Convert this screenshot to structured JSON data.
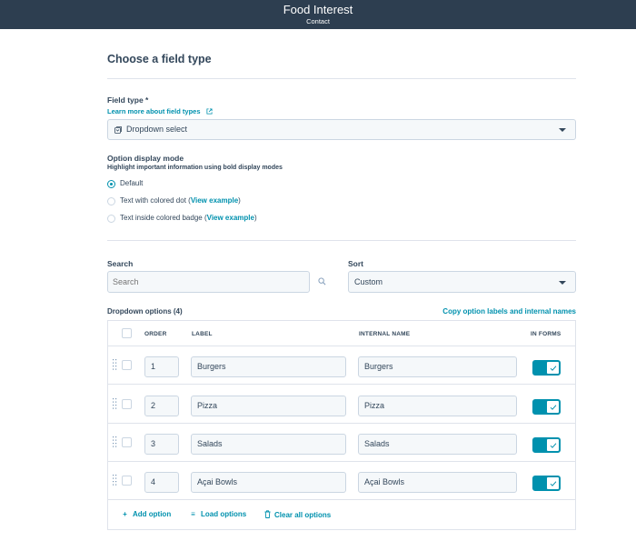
{
  "header": {
    "title": "Food Interest",
    "subtitle": "Contact"
  },
  "section_title": "Choose a field type",
  "field_type": {
    "label": "Field type *",
    "help_link": "Learn more about field types",
    "selected": "Dropdown select"
  },
  "display_mode": {
    "label": "Option display mode",
    "helper": "Highlight important information using bold display modes",
    "options": [
      {
        "text": "Default",
        "link": "",
        "suffix": "",
        "checked": true
      },
      {
        "text": "Text with colored dot (",
        "link": "View example",
        "suffix": ")",
        "checked": false
      },
      {
        "text": "Text inside colored badge (",
        "link": "View example",
        "suffix": ")",
        "checked": false
      }
    ]
  },
  "search": {
    "label": "Search",
    "placeholder": "Search"
  },
  "sort": {
    "label": "Sort",
    "selected": "Custom"
  },
  "options_table": {
    "title": "Dropdown options (4)",
    "copy_link": "Copy option labels and internal names",
    "columns": {
      "order": "ORDER",
      "label": "LABEL",
      "internal_name": "INTERNAL NAME",
      "in_forms": "IN FORMS"
    },
    "rows": [
      {
        "order": "1",
        "label": "Burgers",
        "internal_name": "Burgers",
        "in_forms": true
      },
      {
        "order": "2",
        "label": "Pizza",
        "internal_name": "Pizza",
        "in_forms": true
      },
      {
        "order": "3",
        "label": "Salads",
        "internal_name": "Salads",
        "in_forms": true
      },
      {
        "order": "4",
        "label": "Açai Bowls",
        "internal_name": "Açai Bowls",
        "in_forms": true
      }
    ],
    "actions": {
      "add": {
        "label": "Add option",
        "icon": "plus-icon"
      },
      "load": {
        "label": "Load options",
        "icon": "list-icon"
      },
      "clear": {
        "label": "Clear all options",
        "icon": "trash-icon"
      }
    }
  },
  "colors": {
    "header_bg": "#2d3e50",
    "accent": "#0091ae",
    "text": "#33475b",
    "input_bg": "#f5f8fa",
    "border": "#cbd6e2"
  }
}
